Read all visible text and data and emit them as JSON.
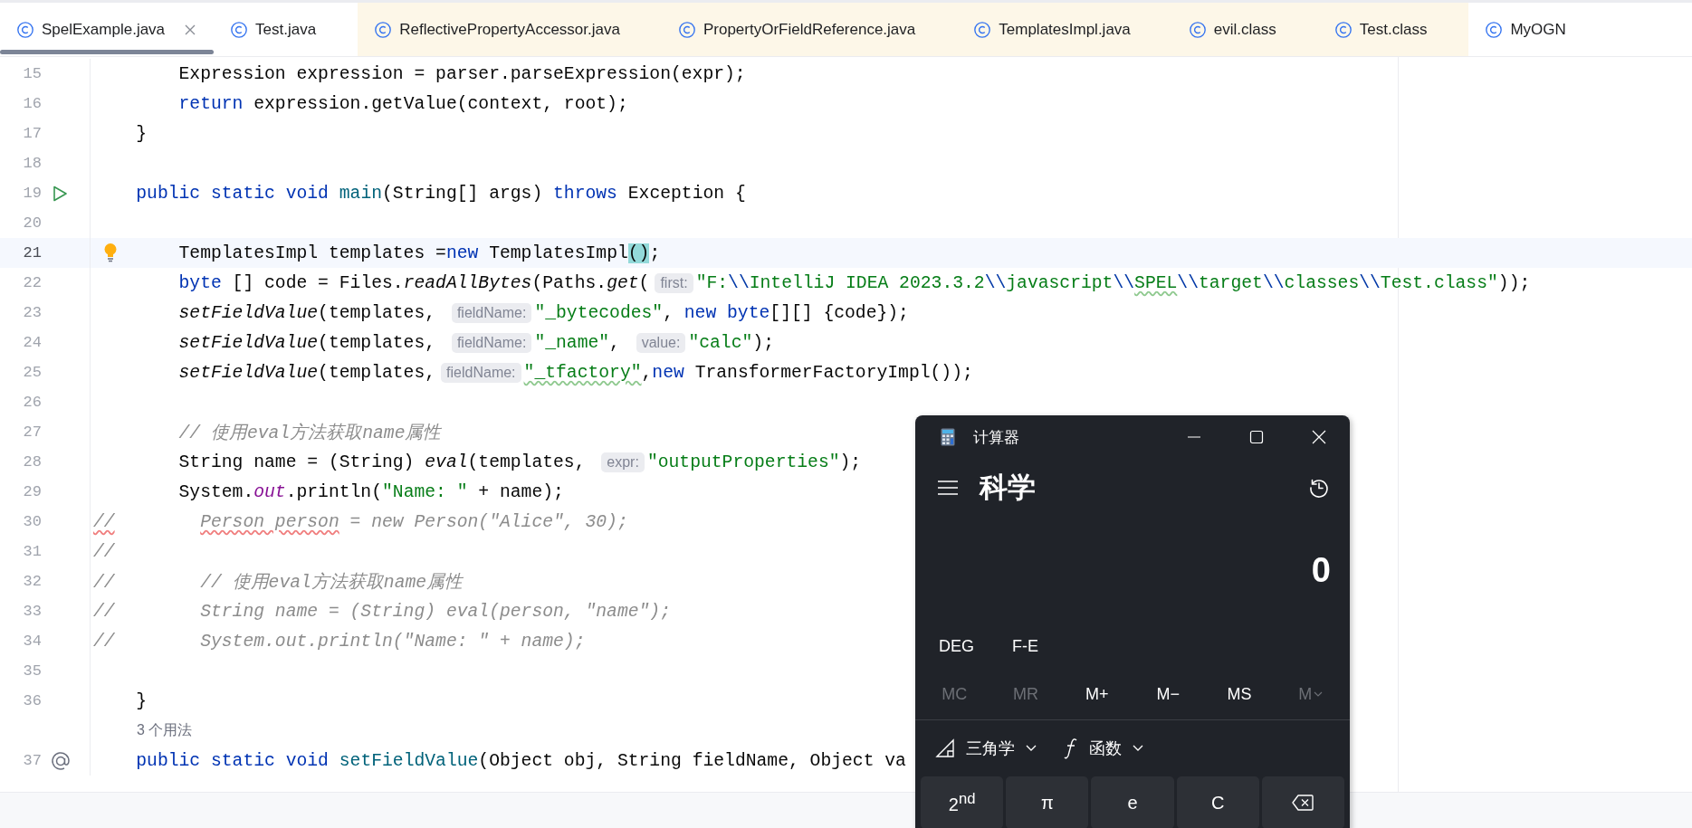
{
  "tabs": [
    {
      "label": "SpelExample.java",
      "selected": true,
      "kind": "project"
    },
    {
      "label": "Test.java",
      "selected": false,
      "kind": "project"
    },
    {
      "label": "ReflectivePropertyAccessor.java",
      "selected": false,
      "kind": "library"
    },
    {
      "label": "PropertyOrFieldReference.java",
      "selected": false,
      "kind": "library"
    },
    {
      "label": "TemplatesImpl.java",
      "selected": false,
      "kind": "library"
    },
    {
      "label": "evil.class",
      "selected": false,
      "kind": "library"
    },
    {
      "label": "Test.class",
      "selected": false,
      "kind": "library"
    },
    {
      "label": "MyOGN",
      "selected": false,
      "kind": "project"
    }
  ],
  "editor": {
    "lines": [
      {
        "kind": "code",
        "number": "15",
        "current": false,
        "tokens": [
          {
            "kind": "plain",
            "text": "        Expression expression = parser.parseExpression(expr);"
          }
        ]
      },
      {
        "kind": "code",
        "number": "16",
        "current": false,
        "tokens": [
          {
            "kind": "keyword",
            "text": "        return"
          },
          {
            "kind": "plain",
            "text": " expression.getValue(context, root);"
          }
        ]
      },
      {
        "kind": "code",
        "number": "17",
        "current": false,
        "tokens": [
          {
            "kind": "plain",
            "text": "    }"
          }
        ]
      },
      {
        "kind": "code",
        "number": "18",
        "current": false
      },
      {
        "kind": "run",
        "number": "19",
        "current": false,
        "tokens": [
          {
            "kind": "keyword",
            "text": "    public static void "
          },
          {
            "kind": "decl",
            "text": "main"
          },
          {
            "kind": "plain",
            "text": "(String[] args) "
          },
          {
            "kind": "keyword",
            "text": "throws"
          },
          {
            "kind": "plain",
            "text": " Exception {"
          }
        ]
      },
      {
        "kind": "code",
        "number": "20",
        "current": false
      },
      {
        "kind": "intention",
        "number": "21",
        "current": true,
        "tokens": [
          {
            "kind": "plain",
            "text": "        TemplatesImpl templates ="
          },
          {
            "kind": "keyword",
            "text": "new"
          },
          {
            "kind": "plain",
            "text": " TemplatesImpl"
          },
          {
            "kind": "match",
            "text": "()"
          },
          {
            "kind": "plain",
            "text": ";"
          }
        ]
      },
      {
        "kind": "code",
        "number": "22",
        "current": false,
        "tokens": [
          {
            "kind": "keyword",
            "text": "        byte"
          },
          {
            "kind": "plain",
            "text": " [] code = Files."
          },
          {
            "kind": "call",
            "text": "readAllBytes"
          },
          {
            "kind": "plain",
            "text": "(Paths."
          },
          {
            "kind": "call",
            "text": "get"
          },
          {
            "kind": "plain",
            "text": "("
          },
          {
            "kind": "hint",
            "text": "first:"
          },
          {
            "kind": "string",
            "text": "\"F:"
          },
          {
            "kind": "escape",
            "text": "\\\\"
          },
          {
            "kind": "string",
            "text": "IntelliJ IDEA 2023.3.2"
          },
          {
            "kind": "escape",
            "text": "\\\\"
          },
          {
            "kind": "string",
            "text": "javascript"
          },
          {
            "kind": "escape",
            "text": "\\\\"
          },
          {
            "kind": "typo-string",
            "text": "SPEL"
          },
          {
            "kind": "escape",
            "text": "\\\\"
          },
          {
            "kind": "string",
            "text": "target"
          },
          {
            "kind": "escape",
            "text": "\\\\"
          },
          {
            "kind": "string",
            "text": "classes"
          },
          {
            "kind": "escape",
            "text": "\\\\"
          },
          {
            "kind": "string",
            "text": "Test.class\""
          },
          {
            "kind": "plain",
            "text": "));"
          }
        ]
      },
      {
        "kind": "code",
        "number": "23",
        "current": false,
        "tokens": [
          {
            "kind": "call",
            "text": "        setFieldValue"
          },
          {
            "kind": "plain",
            "text": "(templates, "
          },
          {
            "kind": "hint",
            "text": "fieldName:"
          },
          {
            "kind": "string",
            "text": "\"_bytecodes\""
          },
          {
            "kind": "plain",
            "text": ", "
          },
          {
            "kind": "keyword",
            "text": "new byte"
          },
          {
            "kind": "plain",
            "text": "[][] {code});"
          }
        ]
      },
      {
        "kind": "code",
        "number": "24",
        "current": false,
        "tokens": [
          {
            "kind": "call",
            "text": "        setFieldValue"
          },
          {
            "kind": "plain",
            "text": "(templates, "
          },
          {
            "kind": "hint",
            "text": "fieldName:"
          },
          {
            "kind": "string",
            "text": "\"_name\""
          },
          {
            "kind": "plain",
            "text": ", "
          },
          {
            "kind": "hint",
            "text": "value:"
          },
          {
            "kind": "string",
            "text": "\"calc\""
          },
          {
            "kind": "plain",
            "text": ");"
          }
        ]
      },
      {
        "kind": "code",
        "number": "25",
        "current": false,
        "tokens": [
          {
            "kind": "call",
            "text": "        setFieldValue"
          },
          {
            "kind": "plain",
            "text": "(templates,"
          },
          {
            "kind": "hint",
            "text": "fieldName:"
          },
          {
            "kind": "typo-string",
            "text": "\"_tfactory\""
          },
          {
            "kind": "plain",
            "text": ","
          },
          {
            "kind": "keyword",
            "text": "new"
          },
          {
            "kind": "plain",
            "text": " TransformerFactoryImpl());"
          }
        ]
      },
      {
        "kind": "code",
        "number": "26",
        "current": false
      },
      {
        "kind": "code",
        "number": "27",
        "current": false,
        "tokens": [
          {
            "kind": "comment",
            "text": "        // 使用eval方法获取name属性"
          }
        ]
      },
      {
        "kind": "code",
        "number": "28",
        "current": false,
        "tokens": [
          {
            "kind": "plain",
            "text": "        String name = (String) "
          },
          {
            "kind": "call",
            "text": "eval"
          },
          {
            "kind": "plain",
            "text": "(templates, "
          },
          {
            "kind": "hint",
            "text": "expr:"
          },
          {
            "kind": "string",
            "text": "\"outputProperties\""
          },
          {
            "kind": "plain",
            "text": ");"
          }
        ]
      },
      {
        "kind": "code",
        "number": "29",
        "current": false,
        "tokens": [
          {
            "kind": "plain",
            "text": "        System."
          },
          {
            "kind": "field",
            "text": "out"
          },
          {
            "kind": "plain",
            "text": ".println("
          },
          {
            "kind": "string",
            "text": "\"Name: \""
          },
          {
            "kind": "plain",
            "text": " + name);"
          }
        ]
      },
      {
        "kind": "code",
        "number": "30",
        "current": false,
        "tokens": [
          {
            "kind": "error-comment",
            "text": "//"
          },
          {
            "kind": "error-comment",
            "text": "        Person person"
          },
          {
            "kind": "comment",
            "text": " = new Person(\"Alice\", 30);"
          }
        ]
      },
      {
        "kind": "code",
        "number": "31",
        "current": false,
        "tokens": [
          {
            "kind": "comment",
            "text": "//"
          }
        ]
      },
      {
        "kind": "code",
        "number": "32",
        "current": false,
        "tokens": [
          {
            "kind": "comment",
            "text": "//        // 使用eval方法获取name属性"
          }
        ]
      },
      {
        "kind": "code",
        "number": "33",
        "current": false,
        "tokens": [
          {
            "kind": "comment",
            "text": "//        String name = (String) eval(person, \"name\");"
          }
        ]
      },
      {
        "kind": "code",
        "number": "34",
        "current": false,
        "tokens": [
          {
            "kind": "comment",
            "text": "//        System.out.println(\"Name: \" + name);"
          }
        ]
      },
      {
        "kind": "code",
        "number": "35",
        "current": false
      },
      {
        "kind": "code",
        "number": "36",
        "current": false,
        "tokens": [
          {
            "kind": "plain",
            "text": "    }"
          }
        ]
      },
      {
        "kind": "usage",
        "text": "3 个用法"
      },
      {
        "kind": "override",
        "number": "37",
        "current": false,
        "tokens": [
          {
            "kind": "keyword",
            "text": "    public static void "
          },
          {
            "kind": "decl",
            "text": "setFieldValue"
          },
          {
            "kind": "plain",
            "text": "(Object obj, String fieldName, Object va"
          }
        ]
      }
    ]
  },
  "calculator": {
    "title": "计算器",
    "mode": "科学",
    "display": "0",
    "angle_unit": "DEG",
    "notation": "F-E",
    "memory": [
      {
        "label": "MC",
        "kind": "button",
        "disabled": true
      },
      {
        "label": "MR",
        "kind": "button",
        "disabled": true
      },
      {
        "label": "M+",
        "kind": "button",
        "disabled": false
      },
      {
        "label": "M−",
        "kind": "button",
        "disabled": false
      },
      {
        "label": "MS",
        "kind": "button",
        "disabled": false
      },
      {
        "label": "M",
        "kind": "dropdown",
        "disabled": true
      }
    ],
    "menus": [
      {
        "label": "三角学",
        "kind": "trigonometry"
      },
      {
        "label": "函数",
        "kind": "function"
      }
    ],
    "keys": [
      {
        "kind": "text",
        "label": "2$^{nd}$"
      },
      {
        "kind": "text",
        "label": "π"
      },
      {
        "kind": "text",
        "label": "e"
      },
      {
        "kind": "text",
        "label": "C"
      },
      {
        "kind": "backspace"
      }
    ]
  }
}
